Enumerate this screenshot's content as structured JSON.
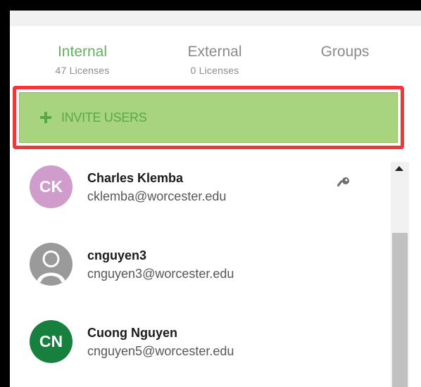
{
  "tabs": [
    {
      "label": "Internal",
      "sub": "47 Licenses",
      "active": true
    },
    {
      "label": "External",
      "sub": "0 Licenses",
      "active": false
    },
    {
      "label": "Groups",
      "sub": "",
      "active": false
    }
  ],
  "invite": {
    "label": "INVITE USERS",
    "icon": "plus-icon"
  },
  "users": [
    {
      "initials": "CK",
      "name": "Charles Klemba",
      "email": "cklemba@worcester.edu",
      "avatar_color": "#cf9ccb",
      "has_key": true
    },
    {
      "initials": "",
      "name": "cnguyen3",
      "email": "cnguyen3@worcester.edu",
      "avatar_color": "#9a9a9a",
      "has_key": false
    },
    {
      "initials": "CN",
      "name": "Cuong Nguyen",
      "email": "cnguyen5@worcester.edu",
      "avatar_color": "#17803f",
      "has_key": false
    }
  ],
  "colors": {
    "active_tab": "#5fb35b",
    "invite_bg": "#a9d47f",
    "highlight_border": "#f0383b"
  }
}
